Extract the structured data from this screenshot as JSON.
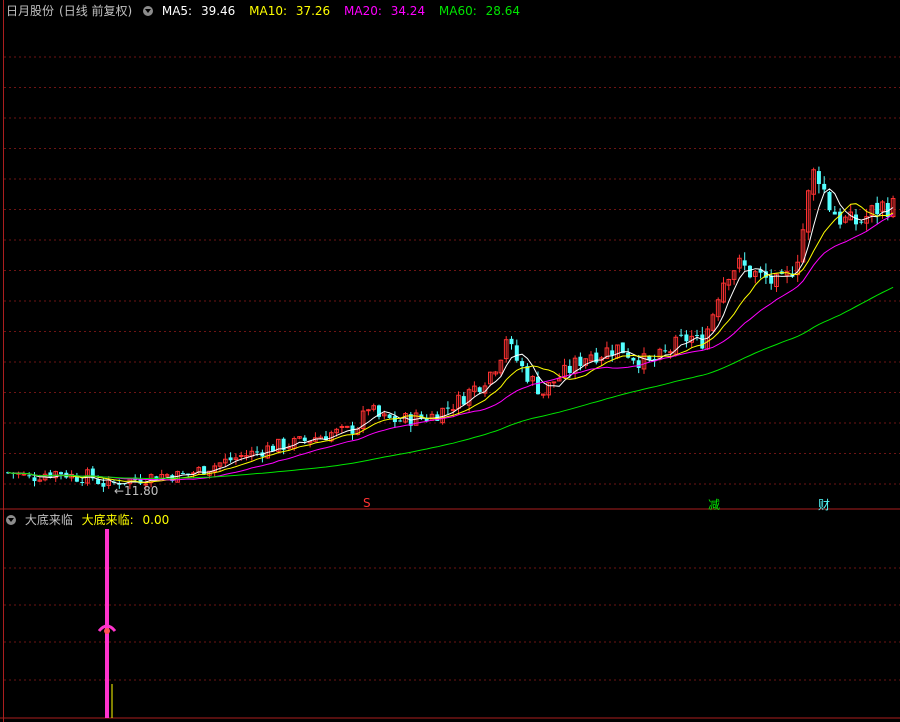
{
  "colors": {
    "up": "#ff3232",
    "down": "#54ffff",
    "ma5": "#ffffff",
    "ma10": "#ffff00",
    "ma20": "#ff00ff",
    "ma60": "#00e600",
    "grid": "#6e1414",
    "frame": "#aa1e1e",
    "label": "#c0c0c0",
    "indicator": "#ff33cc"
  },
  "main_panel": {
    "stock_name": "日月股份",
    "period_label": "(日线 前复权)",
    "ma_legend": [
      {
        "name": "MA5:",
        "value": "39.46",
        "color": "#ffffff"
      },
      {
        "name": "MA10:",
        "value": "37.26",
        "color": "#ffff00"
      },
      {
        "name": "MA20:",
        "value": "34.24",
        "color": "#ff00ff"
      },
      {
        "name": "MA60:",
        "value": "28.64",
        "color": "#00e600"
      }
    ],
    "low_annotation": "←11.80",
    "markers": [
      {
        "text": "S",
        "color": "#ff3232"
      },
      {
        "text": "减",
        "color": "#00e600"
      },
      {
        "text": "财",
        "color": "#54ffff"
      }
    ]
  },
  "indicator_panel": {
    "name": "大底来临",
    "series_label": "大底来临:",
    "series_value": "0.00"
  },
  "chart_data": [
    {
      "type": "candlestick",
      "title": "",
      "price_range": [
        10,
        48
      ],
      "x": [
        0,
        15,
        30,
        45,
        60,
        75,
        90,
        100,
        108,
        114,
        120,
        135,
        150,
        165,
        180,
        195,
        210,
        225,
        240,
        255,
        270,
        285,
        300,
        315,
        330,
        345,
        360,
        370,
        375,
        385,
        400,
        415,
        430,
        445,
        460,
        470,
        480,
        490,
        500,
        505,
        510,
        520,
        530,
        540,
        545,
        550,
        560,
        570,
        580,
        590,
        600,
        610,
        620,
        630,
        640,
        650,
        660,
        670,
        680,
        690,
        700,
        710,
        715,
        720,
        730,
        740,
        750,
        760,
        770,
        780,
        790,
        800,
        805,
        810,
        815,
        820,
        825,
        830,
        840,
        850,
        860,
        870,
        880,
        890,
        900
      ],
      "close_estimate": [
        12.9,
        12.8,
        12.4,
        12.8,
        12.9,
        12.5,
        12.6,
        12.1,
        11.8,
        12.0,
        12.2,
        12.3,
        12.5,
        12.7,
        12.6,
        12.9,
        13.3,
        13.7,
        14.1,
        14.4,
        14.8,
        15.0,
        15.2,
        15.6,
        15.9,
        16.0,
        16.6,
        18.3,
        17.2,
        17.0,
        16.9,
        17.1,
        17.2,
        17.8,
        18.5,
        19.2,
        19.8,
        20.6,
        21.8,
        23.8,
        22.5,
        21.2,
        20.2,
        19.3,
        19.0,
        19.8,
        20.3,
        20.9,
        21.6,
        22.2,
        22.1,
        22.5,
        22.6,
        22.1,
        21.6,
        21.3,
        21.8,
        22.4,
        23.0,
        23.5,
        22.8,
        24.5,
        26.0,
        27.4,
        28.8,
        29.0,
        28.5,
        28.1,
        27.8,
        27.4,
        28.3,
        30.4,
        32.8,
        35.2,
        36.5,
        36.0,
        34.6,
        33.6,
        32.7,
        32.3,
        32.4,
        33.0,
        33.6,
        33.7,
        33.2
      ],
      "markers": [
        {
          "label": "S",
          "x": 368
        },
        {
          "label": "减",
          "x": 714
        },
        {
          "label": "财",
          "x": 824
        }
      ],
      "annotations": [
        {
          "text": "←11.80",
          "x": 108,
          "y": 11.8
        }
      ],
      "series": [
        {
          "name": "MA5",
          "latest": 39.46
        },
        {
          "name": "MA10",
          "latest": 37.26
        },
        {
          "name": "MA20",
          "latest": 34.24
        },
        {
          "name": "MA60",
          "latest": 28.64
        }
      ],
      "grid": true
    },
    {
      "type": "bar",
      "title": "",
      "series": [
        {
          "name": "大底来临",
          "x": [
            107
          ],
          "values": [
            100
          ],
          "latest": 0.0
        }
      ],
      "ylim": [
        0,
        100
      ],
      "grid": true
    }
  ]
}
